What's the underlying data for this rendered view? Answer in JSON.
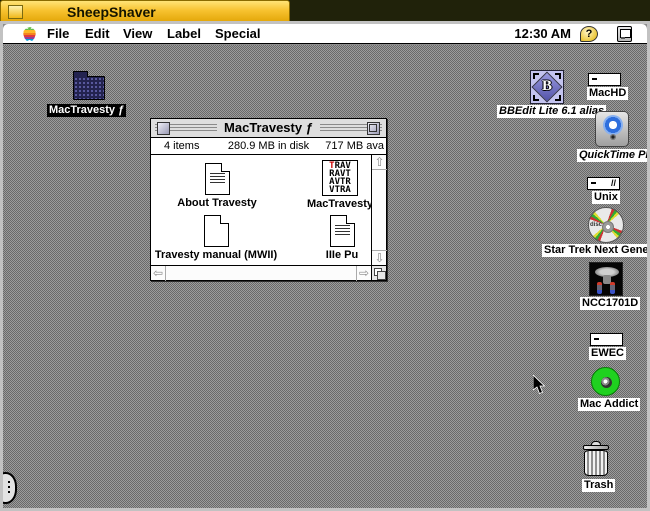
{
  "wm": {
    "title": "SheepShaver"
  },
  "menubar": {
    "menus": [
      "File",
      "Edit",
      "View",
      "Label",
      "Special"
    ],
    "clock": "12:30 AM",
    "help_glyph": "?"
  },
  "finder_window": {
    "title": "MacTravesty ƒ",
    "items_count": "4 items",
    "disk_usage": "280.9 MB in disk",
    "disk_available": "717 MB ava",
    "icon_about_label": "About Travesty",
    "icon_app_label": "MacTravesty",
    "icon_manual_label": "Travesty manual (MWII)",
    "icon_iie_label": "IIIe Pu",
    "app_art": {
      "r0a": "T",
      "r0b": "RAV",
      "r1": "RAVT",
      "r2": "AVTR",
      "r3": "VTRA"
    }
  },
  "desktop": {
    "folder_label": "MacTravesty ƒ",
    "bbedit_label": "BBEdit Lite 6.1 alias",
    "bbedit_letter": "B",
    "machd_label": "MacHD",
    "quicktime_label": "QuickTime Player",
    "unix_label": "Unix",
    "startrek_label": "Star Trek Next Genera",
    "cd_small_text": "disc",
    "ncc_label": "NCC1701D",
    "ewec_label": "EWEC",
    "macaddict_label": "Mac Addict",
    "trash_label": "Trash"
  },
  "scroll_icons": {
    "up": "⇧",
    "down": "⇩",
    "left": "⇦",
    "right": "⇨"
  },
  "colors": {
    "tab_yellow": "#f7c230",
    "desktop_dark": "#696969",
    "desktop_light": "#9c9c9c",
    "travesty_red": "#cc0000"
  }
}
